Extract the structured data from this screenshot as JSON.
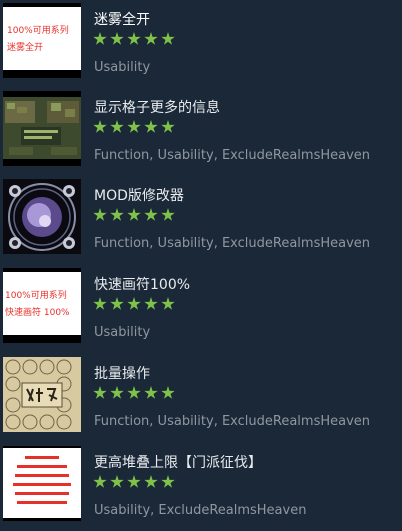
{
  "mods": [
    {
      "title": "迷雾全开",
      "rating": 5,
      "tags": "Usability",
      "thumb_icon": "red-text-thumbnail",
      "thumb_lines": [
        "100%可用系列",
        "迷雾全开"
      ]
    },
    {
      "title": "显示格子更多的信息",
      "rating": 5,
      "tags": "Function, Usability, ExcludeRealmsHeaven",
      "thumb_icon": "game-map-screenshot-thumbnail",
      "thumb_lines": []
    },
    {
      "title": "MOD版修改器",
      "rating": 5,
      "tags": "Function, Usability, ExcludeRealmsHeaven",
      "thumb_icon": "taiji-circle-art-thumbnail",
      "thumb_lines": []
    },
    {
      "title": "快速画符100%",
      "rating": 5,
      "tags": "Usability",
      "thumb_icon": "red-text-thumbnail",
      "thumb_lines": [
        "100%可用系列",
        "快速画符 100%"
      ]
    },
    {
      "title": "批量操作",
      "rating": 5,
      "tags": "Function, Usability, ExcludeRealmsHeaven",
      "thumb_icon": "calligraphy-grid-thumbnail",
      "thumb_lines": []
    },
    {
      "title": "更高堆叠上限【门派征伐】",
      "rating": 5,
      "tags": "Usability, ExcludeRealmsHeaven",
      "thumb_icon": "red-text-notice-thumbnail",
      "thumb_lines": []
    }
  ],
  "colors": {
    "background": "#1b2838",
    "title": "#e8ebee",
    "tags": "#8f98a0",
    "star": "#7ec24a",
    "thumb_red_text": "#e8302a"
  }
}
